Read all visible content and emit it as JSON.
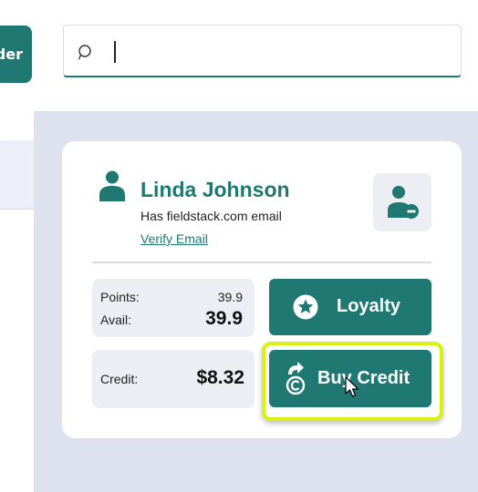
{
  "header": {
    "left_button_label": "der",
    "search": {
      "value": "",
      "placeholder": ""
    }
  },
  "customer": {
    "name": "Linda Johnson",
    "email_note": "Has fieldstack.com email",
    "verify_link": "Verify Email"
  },
  "stats": {
    "points_label": "Points:",
    "points_value": "39.9",
    "avail_label": "Avail:",
    "avail_value": "39.9",
    "credit_label": "Credit:",
    "credit_value": "$8.32"
  },
  "actions": {
    "loyalty_label": "Loyalty",
    "buy_credit_label": "Buy Credit"
  },
  "icons": {
    "search": "search-icon",
    "person": "person-icon",
    "remove_user": "remove-user-icon",
    "loyalty": "star-badge-icon",
    "buy_credit": "credit-share-icon",
    "cursor": "mouse-pointer-icon"
  },
  "colors": {
    "accent": "#1f7872",
    "highlight": "#d8f012",
    "panel_bg": "#dde2ee",
    "tile_bg": "#eceef4"
  }
}
